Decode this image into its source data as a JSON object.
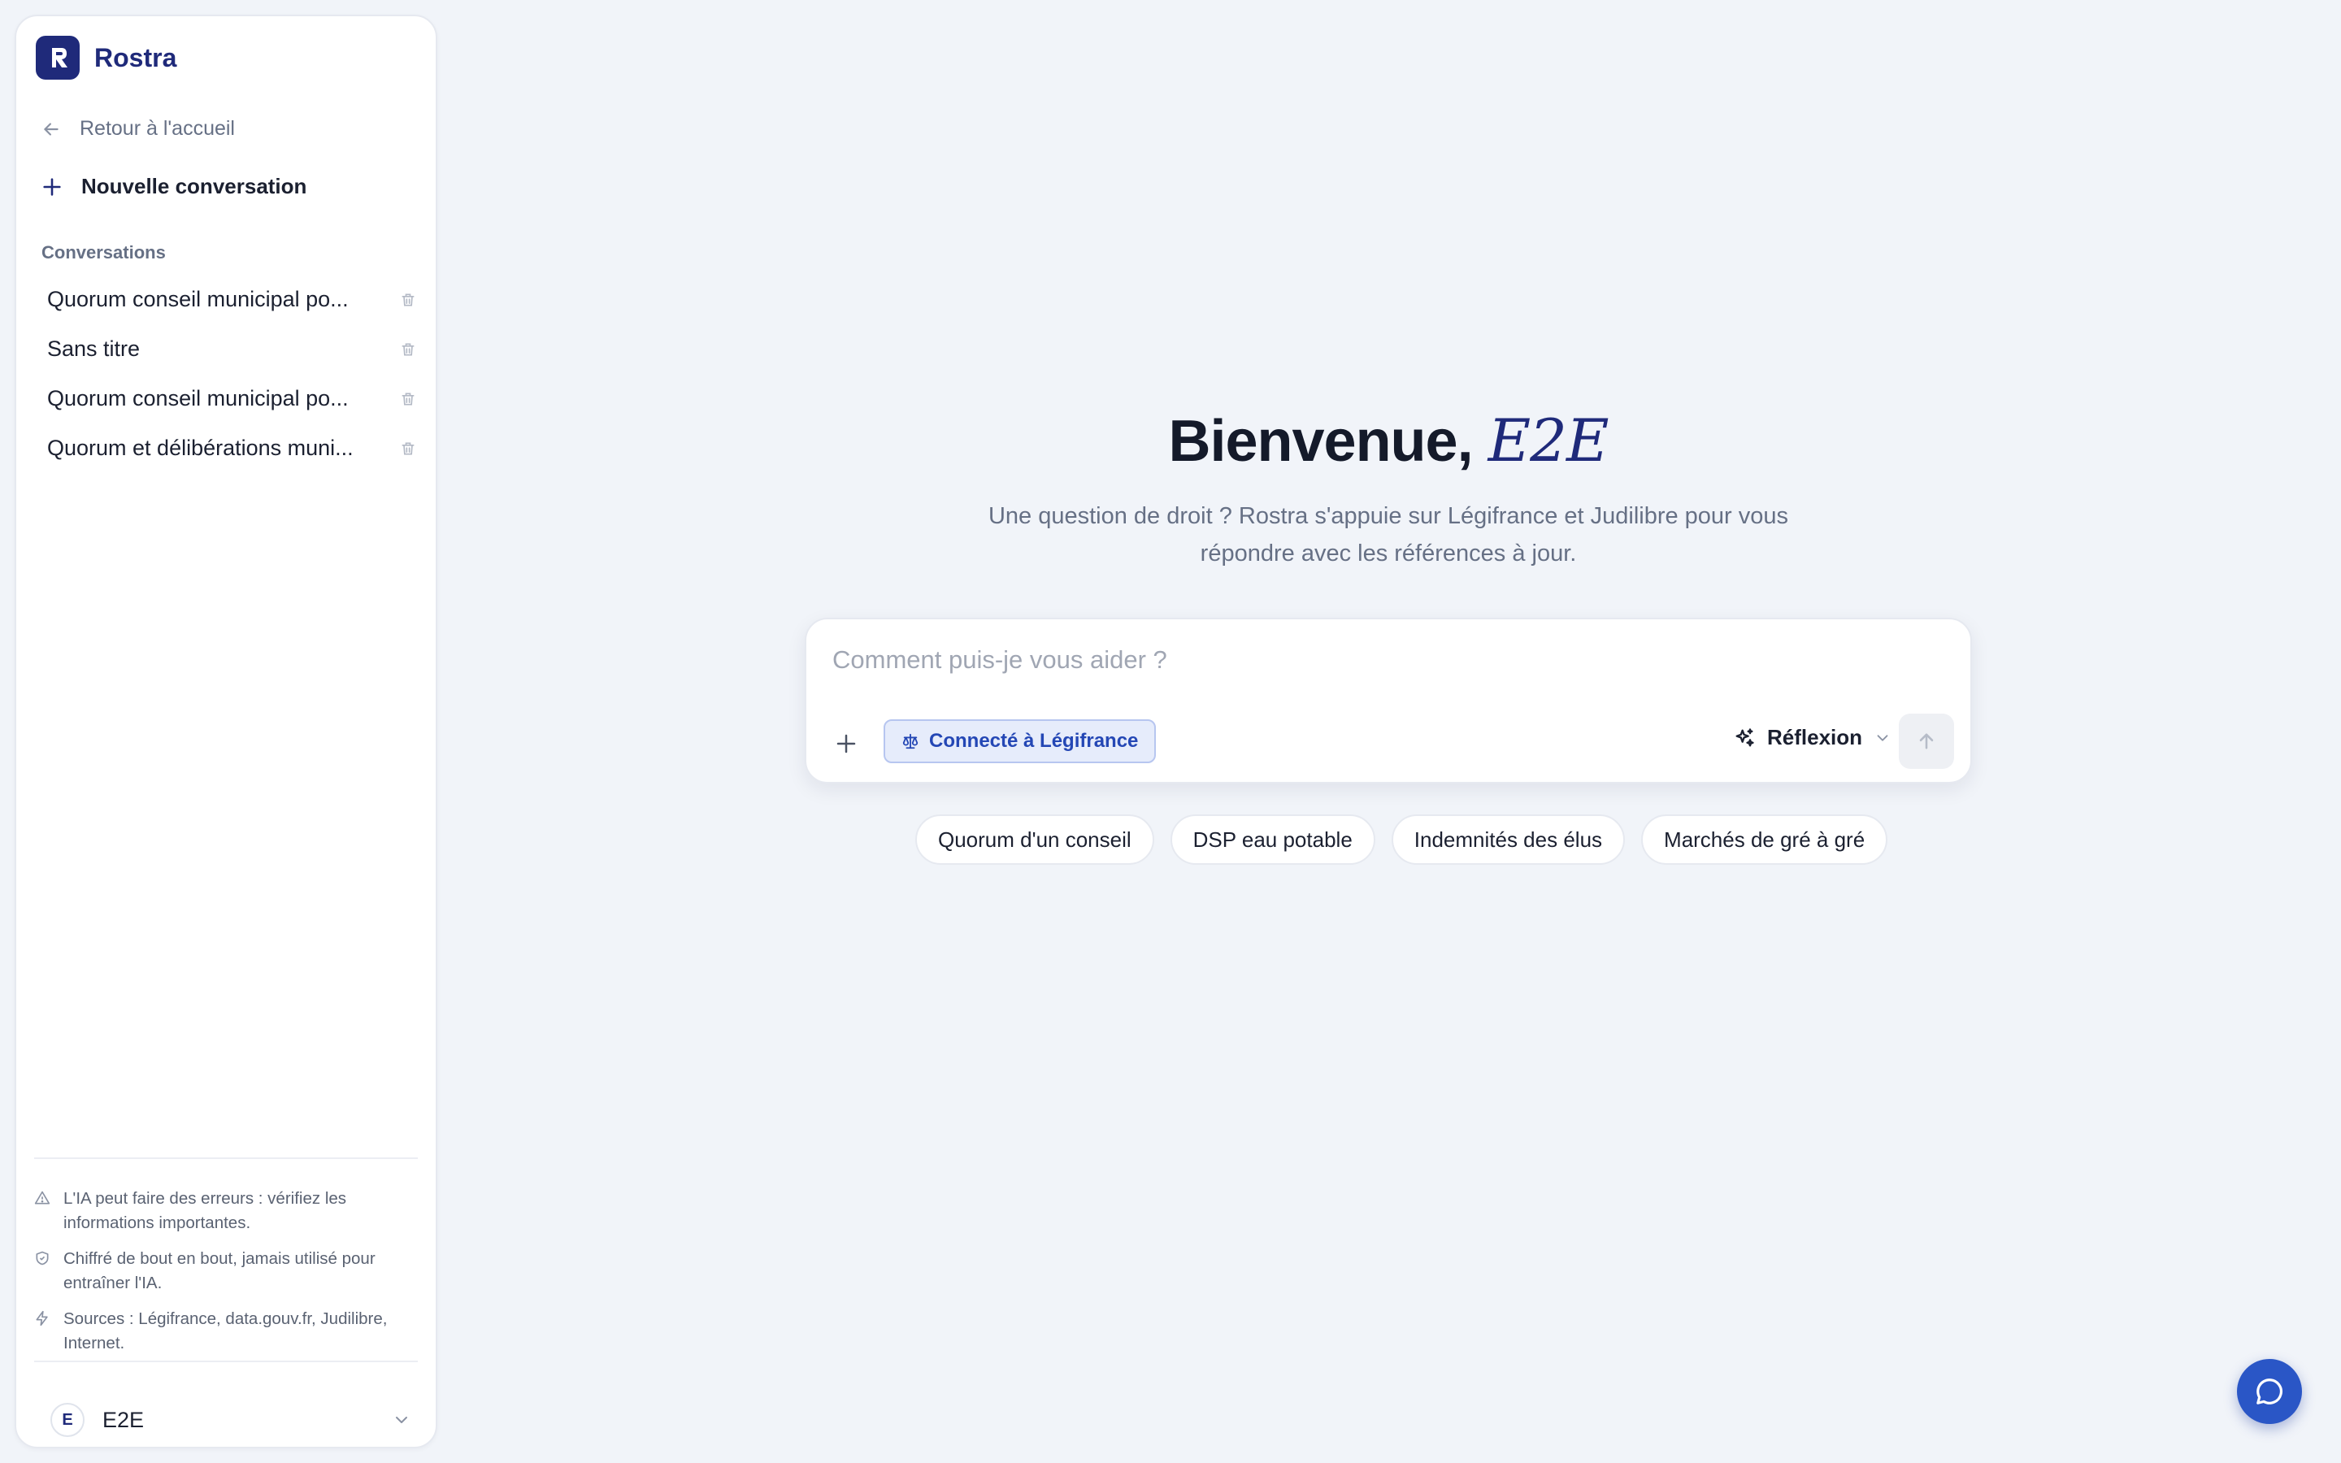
{
  "brand": {
    "name": "Rostra",
    "logo_letter": "R",
    "accent": "#1f2a7a"
  },
  "sidebar": {
    "back_label": "Retour à l'accueil",
    "new_conversation_label": "Nouvelle conversation",
    "conversations_heading": "Conversations",
    "conversations": [
      {
        "label": "Quorum conseil municipal po..."
      },
      {
        "label": "Sans titre"
      },
      {
        "label": "Quorum conseil municipal po..."
      },
      {
        "label": "Quorum et délibérations muni..."
      }
    ],
    "notices": [
      {
        "icon": "warning-triangle-icon",
        "text": "L'IA peut faire des erreurs : vérifiez les informations importantes."
      },
      {
        "icon": "shield-icon",
        "text": "Chiffré de bout en bout, jamais utilisé pour entraîner l'IA."
      },
      {
        "icon": "lightning-icon",
        "text": "Sources : Légifrance, data.gouv.fr, Judilibre, Internet."
      }
    ],
    "user": {
      "initial": "E",
      "name": "E2E"
    }
  },
  "main": {
    "welcome_prefix": "Bienvenue,",
    "welcome_name": "E2E",
    "subtitle_line1": "Une question de droit ? Rostra s'appuie sur Légifrance et Judilibre pour vous",
    "subtitle_line2": "répondre avec les références à jour.",
    "composer": {
      "placeholder": "Comment puis-je vous aider ?",
      "value": "",
      "connection_badge": "Connecté à Légifrance",
      "mode_label": "Réflexion"
    },
    "suggestions": [
      "Quorum d'un conseil",
      "DSP eau potable",
      "Indemnités des élus",
      "Marchés de gré à gré"
    ]
  },
  "colors": {
    "background": "#f1f4f9",
    "badge_bg": "#e6ecfb",
    "badge_text": "#2447b5",
    "fab": "#2a56c6"
  }
}
